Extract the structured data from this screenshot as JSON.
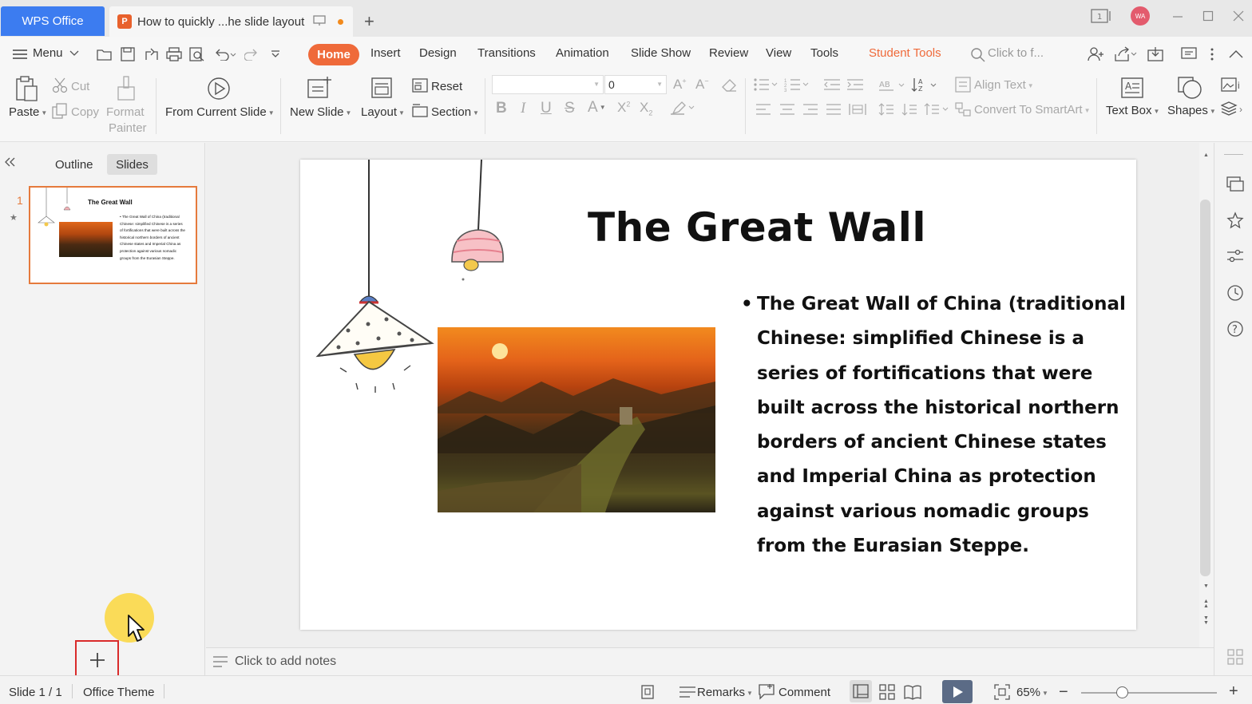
{
  "titlebar": {
    "brand": "WPS Office",
    "doc_tab_icon": "P",
    "doc_tab_title": "How to quickly ...he slide layout",
    "new_tab": "+",
    "avatar": "WA",
    "accent": "#3c7cf0"
  },
  "menu": {
    "menu_label": "Menu",
    "tabs": [
      "Home",
      "Insert",
      "Design",
      "Transitions",
      "Animation",
      "Slide Show",
      "Review",
      "View",
      "Tools"
    ],
    "student_tools": "Student Tools",
    "search_placeholder": "Click to f...",
    "active_color": "#ef6a3a"
  },
  "ribbon": {
    "paste": "Paste",
    "cut": "Cut",
    "copy": "Copy",
    "format_painter_1": "Format",
    "format_painter_2": "Painter",
    "from_current_slide": "From Current Slide",
    "new_slide": "New Slide",
    "layout": "Layout",
    "reset": "Reset",
    "section": "Section",
    "font_size": "0",
    "align_text": "Align Text",
    "convert_smartart": "Convert To SmartArt",
    "text_box": "Text Box",
    "shapes": "Shapes"
  },
  "left_panel": {
    "outline_tab": "Outline",
    "slides_tab": "Slides",
    "slide_number": "1",
    "thumb_title": "The Great Wall",
    "thumb_body": "The Great Wall of China (traditional Chinese: simplified Chinese is a series of fortifications that were built across the historical northern borders of ancient Chinese states and Imperial China as protection against various nomadic groups from the Eurasian Steppe."
  },
  "slide": {
    "title": "The Great Wall",
    "body_lines": [
      "The Great Wall of China (traditional",
      "Chinese:  simplified Chinese is a",
      "series of fortifications that were",
      "built across the historical northern",
      "borders of ancient Chinese states",
      "and Imperial China as protection",
      "against various nomadic groups",
      "from the Eurasian Steppe."
    ]
  },
  "notes": {
    "placeholder": "Click to add notes"
  },
  "status": {
    "slide_count": "Slide 1 / 1",
    "theme": "Office Theme",
    "remarks": "Remarks",
    "comment": "Comment",
    "zoom": "65%"
  }
}
